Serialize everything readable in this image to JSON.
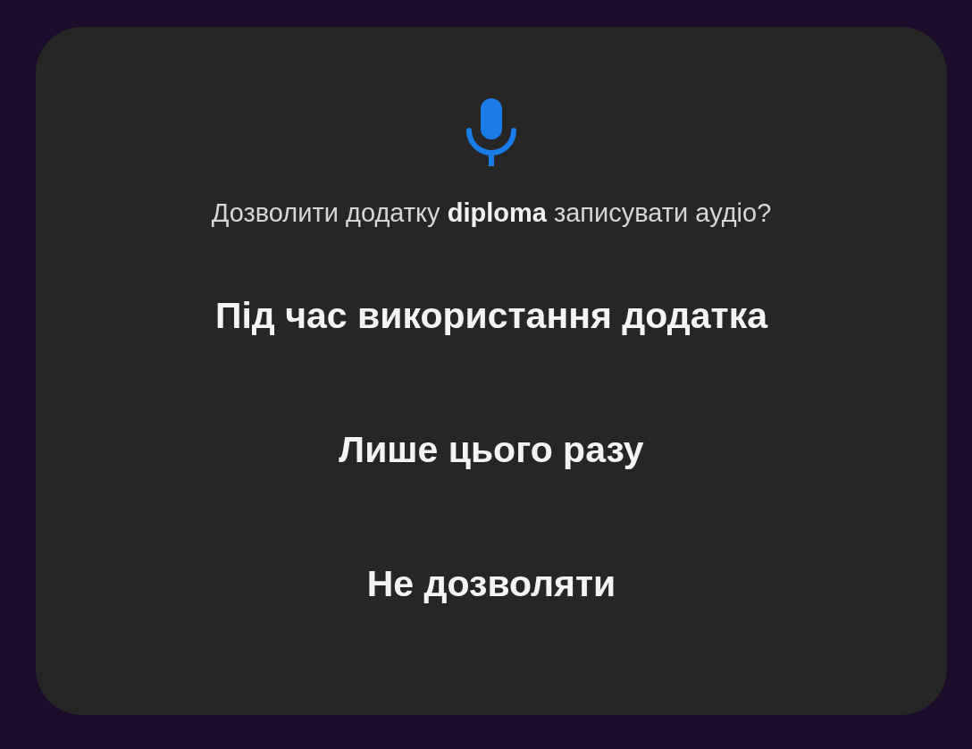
{
  "dialog": {
    "prompt": "Дозволити додатку **diploma** записувати аудіо?",
    "options": [
      {
        "label": "Під час використання додатка"
      },
      {
        "label": "Лише цього разу"
      },
      {
        "label": "Не дозволяти"
      }
    ]
  }
}
